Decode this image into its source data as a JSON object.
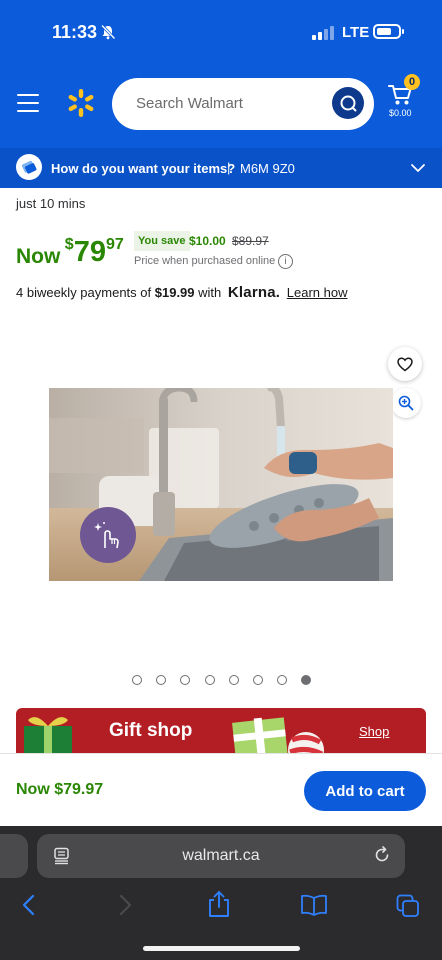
{
  "status_bar": {
    "time": "11:33",
    "network": "LTE"
  },
  "header": {
    "search_placeholder": "Search Walmart",
    "cart_count": "0",
    "cart_total": "$0.00"
  },
  "delivery": {
    "question": "How do you want your items?",
    "separator": "|",
    "postal_code": "M6M 9Z0"
  },
  "product": {
    "truncated_text": "just 10 mins",
    "now_label": "Now",
    "price_dollar_sign": "$",
    "price_main": "79",
    "price_cents": "97",
    "you_save_label": "You save",
    "save_amount": "$10.00",
    "was_price": "$89.97",
    "price_note": "Price when purchased online",
    "info_glyph": "i",
    "klarna_prefix": "4 biweekly payments of",
    "klarna_amount": "$19.99",
    "klarna_with": "with",
    "klarna_brand": "Klarna.",
    "klarna_link": "Learn how"
  },
  "carousel": {
    "total_images": 8,
    "active_index": 7
  },
  "gift_banner": {
    "title": "Gift shop",
    "link": "Shop"
  },
  "bottom_bar": {
    "price": "Now $79.97",
    "add_to_cart": "Add to cart"
  },
  "browser": {
    "url": "walmart.ca"
  },
  "colors": {
    "walmart_blue": "#0b5bdb",
    "price_green": "#2a8703",
    "spark_yellow": "#ffc220",
    "gift_red": "#b31d24",
    "badge_purple": "#6f5794"
  },
  "icons": [
    "bell-slash-icon",
    "signal-icon",
    "battery-icon",
    "menu-icon",
    "walmart-spark-icon",
    "search-icon",
    "cart-icon",
    "delivery-icon",
    "chevron-down-icon",
    "info-icon",
    "heart-icon",
    "zoom-icon",
    "touch-icon",
    "reader-icon",
    "reload-icon",
    "back-icon",
    "forward-icon",
    "share-icon",
    "bookmarks-icon",
    "tabs-icon"
  ]
}
